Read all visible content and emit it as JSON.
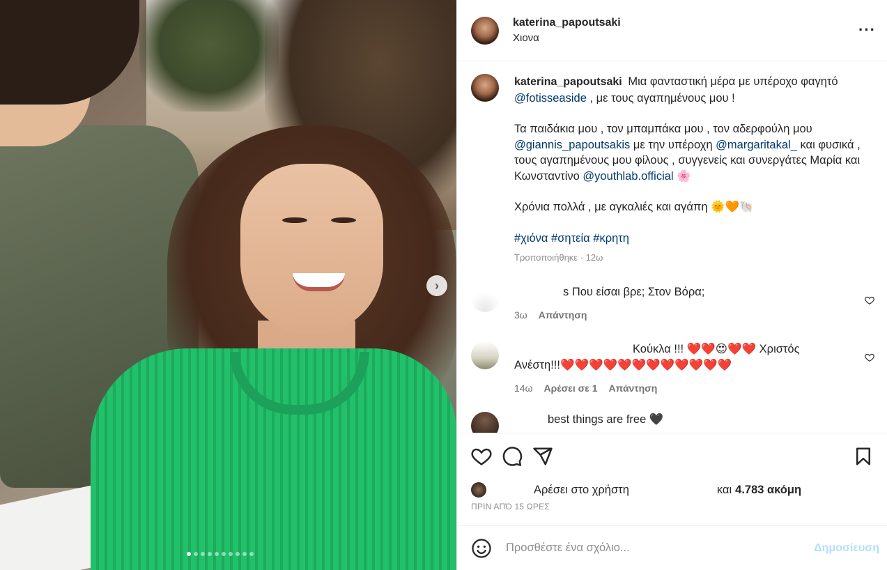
{
  "post": {
    "username": "katerina_papoutsaki",
    "location": "Χιονα",
    "more_icon": "more-horizontal-icon"
  },
  "caption": {
    "username": "katerina_papoutsaki",
    "line1": "Μια φανταστική μέρα με υπέροχο φαγητό",
    "mention1": "@fotisseaside",
    "line1_end": ", με τους αγαπημένους μου !",
    "p2_start": "Τα παιδάκια μου , τον μπαμπάκα μου , τον αδερφούλη μου",
    "mention2": "@giannis_papoutsakis",
    "p2_mid": "με την υπέροχη",
    "mention3": "@margaritakal_",
    "p2_mid2": "και φυσικά , τους αγαπημένους μου φίλους , συγγενείς και συνεργάτες Μαρία και Κωνσταντίνο",
    "mention4": "@youthlab.official",
    "p2_emoji": "🌸",
    "p3": "Χρόνια πολλά , με αγκαλιές και αγάπη",
    "p3_emoji": "🌞🧡🐚",
    "hashtag1": "#χιόνα",
    "hashtag2": "#σητεία",
    "hashtag3": "#κρητη",
    "meta": "Τροποποιήθηκε · 12ω"
  },
  "comments": [
    {
      "text": "s Που είσαι βρε; Στον Βόρα;",
      "time": "3ω",
      "reply": "Απάντηση"
    },
    {
      "text_a": "Κούκλα !!! ❤️❤️😍❤️❤️ Χριστός",
      "text_b": "Ανέστη!!!❤️❤️❤️❤️❤️❤️❤️❤️❤️❤️❤️❤️",
      "time": "14ω",
      "likes": "Αρέσει σε 1",
      "reply": "Απάντηση"
    },
    {
      "text": "best things are free 🖤"
    }
  ],
  "actions": {
    "like_icon": "heart-icon",
    "comment_icon": "comment-icon",
    "share_icon": "send-icon",
    "save_icon": "bookmark-icon"
  },
  "likes": {
    "text1": "Αρέσει στο χρήστη",
    "text2": "και",
    "count": "4.783 ακόμη",
    "time": "ΠΡΙΝ ΑΠΌ 15 ΩΡΕΣ"
  },
  "add_comment": {
    "placeholder": "Προσθέστε ένα σχόλιο...",
    "post_label": "Δημοσίευση"
  },
  "carousel": {
    "total": 10,
    "active": 1
  }
}
